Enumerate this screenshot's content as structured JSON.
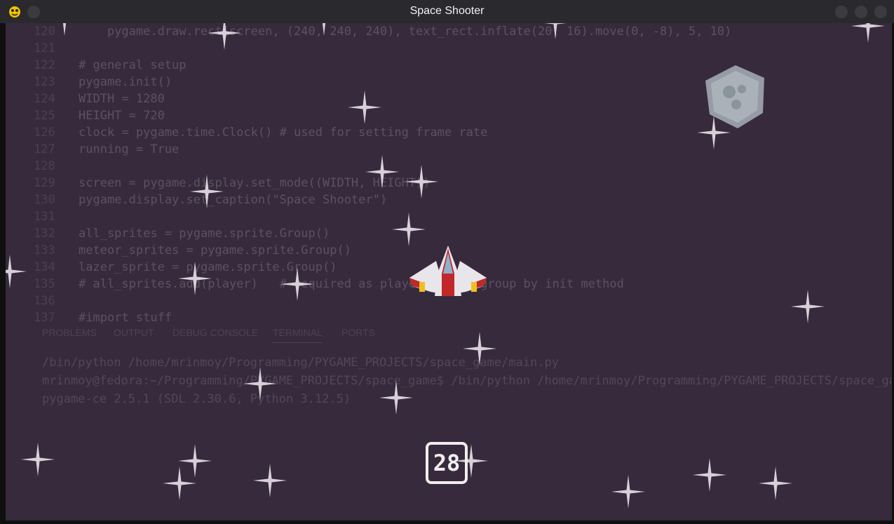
{
  "window": {
    "title": "Space Shooter",
    "app_icon": "pygame-snake-icon",
    "controls": [
      "minimize-icon",
      "maximize-icon",
      "close-icon"
    ]
  },
  "background_overlay": {
    "code_lines": [
      {
        "num": "120",
        "text": "    pygame.draw.rect(screen, (240, 240, 240), text_rect.inflate(20, 16).move(0, -8), 5, 10)"
      },
      {
        "num": "121",
        "text": ""
      },
      {
        "num": "122",
        "text": "# general setup"
      },
      {
        "num": "123",
        "text": "pygame.init()"
      },
      {
        "num": "124",
        "text": "WIDTH = 1280"
      },
      {
        "num": "125",
        "text": "HEIGHT = 720"
      },
      {
        "num": "126",
        "text": "clock = pygame.time.Clock() # used for setting frame rate"
      },
      {
        "num": "127",
        "text": "running = True"
      },
      {
        "num": "128",
        "text": ""
      },
      {
        "num": "129",
        "text": "screen = pygame.display.set_mode((WIDTH, HEIGHT))"
      },
      {
        "num": "130",
        "text": "pygame.display.set_caption(\"Space Shooter\")"
      },
      {
        "num": "131",
        "text": ""
      },
      {
        "num": "132",
        "text": "all_sprites = pygame.sprite.Group()"
      },
      {
        "num": "133",
        "text": "meteor_sprites = pygame.sprite.Group()"
      },
      {
        "num": "134",
        "text": "lazer_sprite = pygame.sprite.Group()"
      },
      {
        "num": "135",
        "text": "# all_sprites.add(player)   # required as player in the group by init method"
      },
      {
        "num": "136",
        "text": ""
      },
      {
        "num": "137",
        "text": "#import stuff"
      }
    ],
    "panel_tabs": [
      "PROBLEMS",
      "OUTPUT",
      "DEBUG CONSOLE",
      "TERMINAL",
      "PORTS"
    ],
    "terminal_lines": [
      "/bin/python /home/mrinmoy/Programming/PYGAME_PROJECTS/space_game/main.py",
      "mrinmoy@fedora:~/Programming/PYGAME_PROJECTS/space_game$ /bin/python /home/mrinmoy/Programming/PYGAME_PROJECTS/space_game",
      "pygame-ce 2.5.1 (SDL 2.30.6, Python 3.12.5)"
    ]
  },
  "game": {
    "score": "28",
    "colors": {
      "space_bg": "#372a3c",
      "star": "#d8d0d8",
      "score": "#eeeeee",
      "ship_body": "#e8e6ea",
      "ship_accent": "#c0282c",
      "ship_engine": "#f0c020",
      "meteor": "#a7b0b8"
    },
    "star_count": 26
  }
}
